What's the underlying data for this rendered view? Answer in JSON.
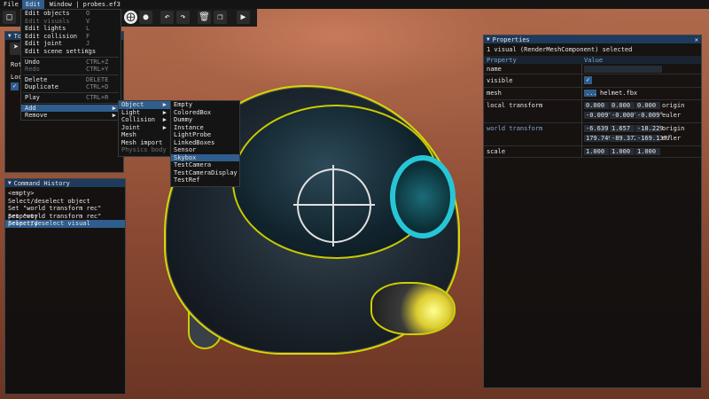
{
  "menubar": {
    "file": "File",
    "edit": "Edit",
    "title": "Window | probes.ef3"
  },
  "toolbar": {
    "icons": [
      "new-file-icon",
      "save-icon",
      "open-icon",
      "move-icon",
      "rotate-icon",
      "scale-icon",
      "gizmo-icon",
      "sphere-icon",
      "undo-icon",
      "redo-icon",
      "delete-icon",
      "copy-icon",
      "play-icon"
    ]
  },
  "edit_menu": {
    "items": [
      {
        "label": "Edit objects",
        "shortcut": "O"
      },
      {
        "label": "Edit visuals",
        "shortcut": "V"
      },
      {
        "label": "Edit lights",
        "shortcut": "L"
      },
      {
        "label": "Edit collision",
        "shortcut": "F"
      },
      {
        "label": "Edit joint",
        "shortcut": "J"
      },
      {
        "label": "Edit scene settings",
        "shortcut": "U"
      },
      {
        "label": "Undo",
        "shortcut": "CTRL+Z"
      },
      {
        "label": "Redo",
        "shortcut": "CTRL+Y"
      },
      {
        "label": "Delete",
        "shortcut": "DELETE"
      },
      {
        "label": "Duplicate",
        "shortcut": "CTRL+D"
      },
      {
        "label": "Play",
        "shortcut": "CTRL+R"
      },
      {
        "label": "Add",
        "shortcut": ""
      },
      {
        "label": "Remove",
        "shortcut": ""
      }
    ]
  },
  "add_submenu": {
    "items": [
      "Object",
      "Light",
      "Collision",
      "Joint",
      "Mesh",
      "Mesh import",
      "Physics body"
    ]
  },
  "object_submenu": {
    "items": [
      "Empty",
      "ColoredBox",
      "Dummy",
      "Instance",
      "LightProbe",
      "LinkedBoxes",
      "Sensor",
      "Skybox",
      "TestCamera",
      "TestCameraDisplay",
      "TestRef"
    ]
  },
  "tools_panel": {
    "title": "To",
    "row1": "Rot",
    "row2": "Loc"
  },
  "history": {
    "title": "Command History",
    "rows": [
      "<empty>",
      "Select/deselect object",
      "Set \"world transform rec\" property",
      "Set \"world transform rec\" property",
      "Select/deselect visual"
    ]
  },
  "properties": {
    "title": "Properties",
    "selected": "1 visual (RenderMeshComponent) selected",
    "col_property": "Property",
    "col_value": "Value",
    "name_label": "name",
    "visible_label": "visible",
    "mesh_label": "mesh",
    "mesh_button": "...",
    "mesh_value": "helmet.fbx",
    "local_label": "local transform",
    "local_origin": [
      "0.000",
      "0.000",
      "0.000"
    ],
    "local_origin_label": "origin",
    "local_euler": [
      "-0.009°",
      "-0.000°",
      "-0.009°"
    ],
    "local_euler_label": "euler",
    "world_label": "world transform",
    "world_origin": [
      "-6.639",
      "1.657",
      "-18.229"
    ],
    "world_origin_label": "origin",
    "world_euler": [
      "179.749°",
      "-89.372°",
      "-169.137°"
    ],
    "world_euler_label": "euler",
    "scale_label": "scale",
    "scale_values": [
      "1.000",
      "1.000",
      "1.000"
    ],
    "accent": "#2f5d8e",
    "field_bg": "#262d36"
  }
}
